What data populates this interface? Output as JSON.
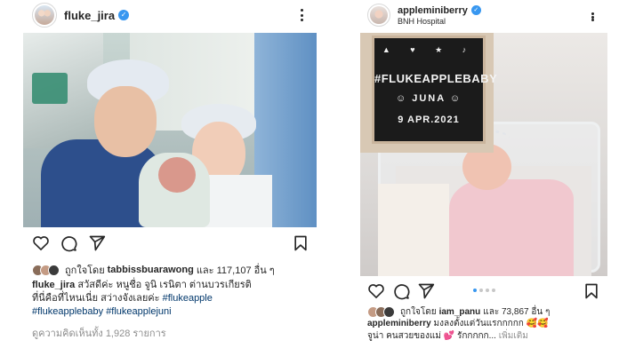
{
  "left_post": {
    "username": "fluke_jira",
    "likes_prefix": "ถูกใจโดย",
    "liked_by": "tabbissbuarawong",
    "likes_suffix": "และ 117,107 อื่น ๆ",
    "caption_user": "fluke_jira",
    "caption_line1": "สวัสดีค่ะ หนูชื่อ จูนิ เรนิตา ต่านบวรเกียรติ",
    "caption_line2_text": "ที่นี่คือที่ไหนเนี่ย สว่างจังเลยค่ะ ",
    "caption_line2_tag": "#flukeapple",
    "caption_line3_tag1": "#flukeapplebaby",
    "caption_line3_tag2": "#flukeapplejuni",
    "view_comments": "ดูความคิดเห็นทั้ง 1,928 รายการ"
  },
  "right_post": {
    "username": "appleminiberry",
    "location": "BNH Hospital",
    "letterboard": {
      "icons": "▲ ♥ ★ ♪",
      "tag": "#FLUKEAPPLEBABY",
      "name": "☺ JUNA ☺",
      "date": "9 APR.2021"
    },
    "likes_prefix": "ถูกใจโดย",
    "liked_by": "iam_panu",
    "likes_suffix": "และ 73,867 อื่น ๆ",
    "caption_user": "appleminiberry",
    "caption_line1": "มงลงตั้งแต่วันแรกกกกก 🥰🥰",
    "caption_line2": "จูน่า คนสวยของแม่ 💕 รักกกกก...",
    "more_link": "เพิ่มเติม"
  },
  "icons": [
    "verified-badge",
    "more-icon",
    "heart-icon",
    "comment-icon",
    "share-icon",
    "save-icon"
  ],
  "colors": {
    "verified": "#3897f0",
    "hashtag": "#00376b",
    "muted": "#8e8e8e",
    "carousel_active": "#3897f0"
  }
}
